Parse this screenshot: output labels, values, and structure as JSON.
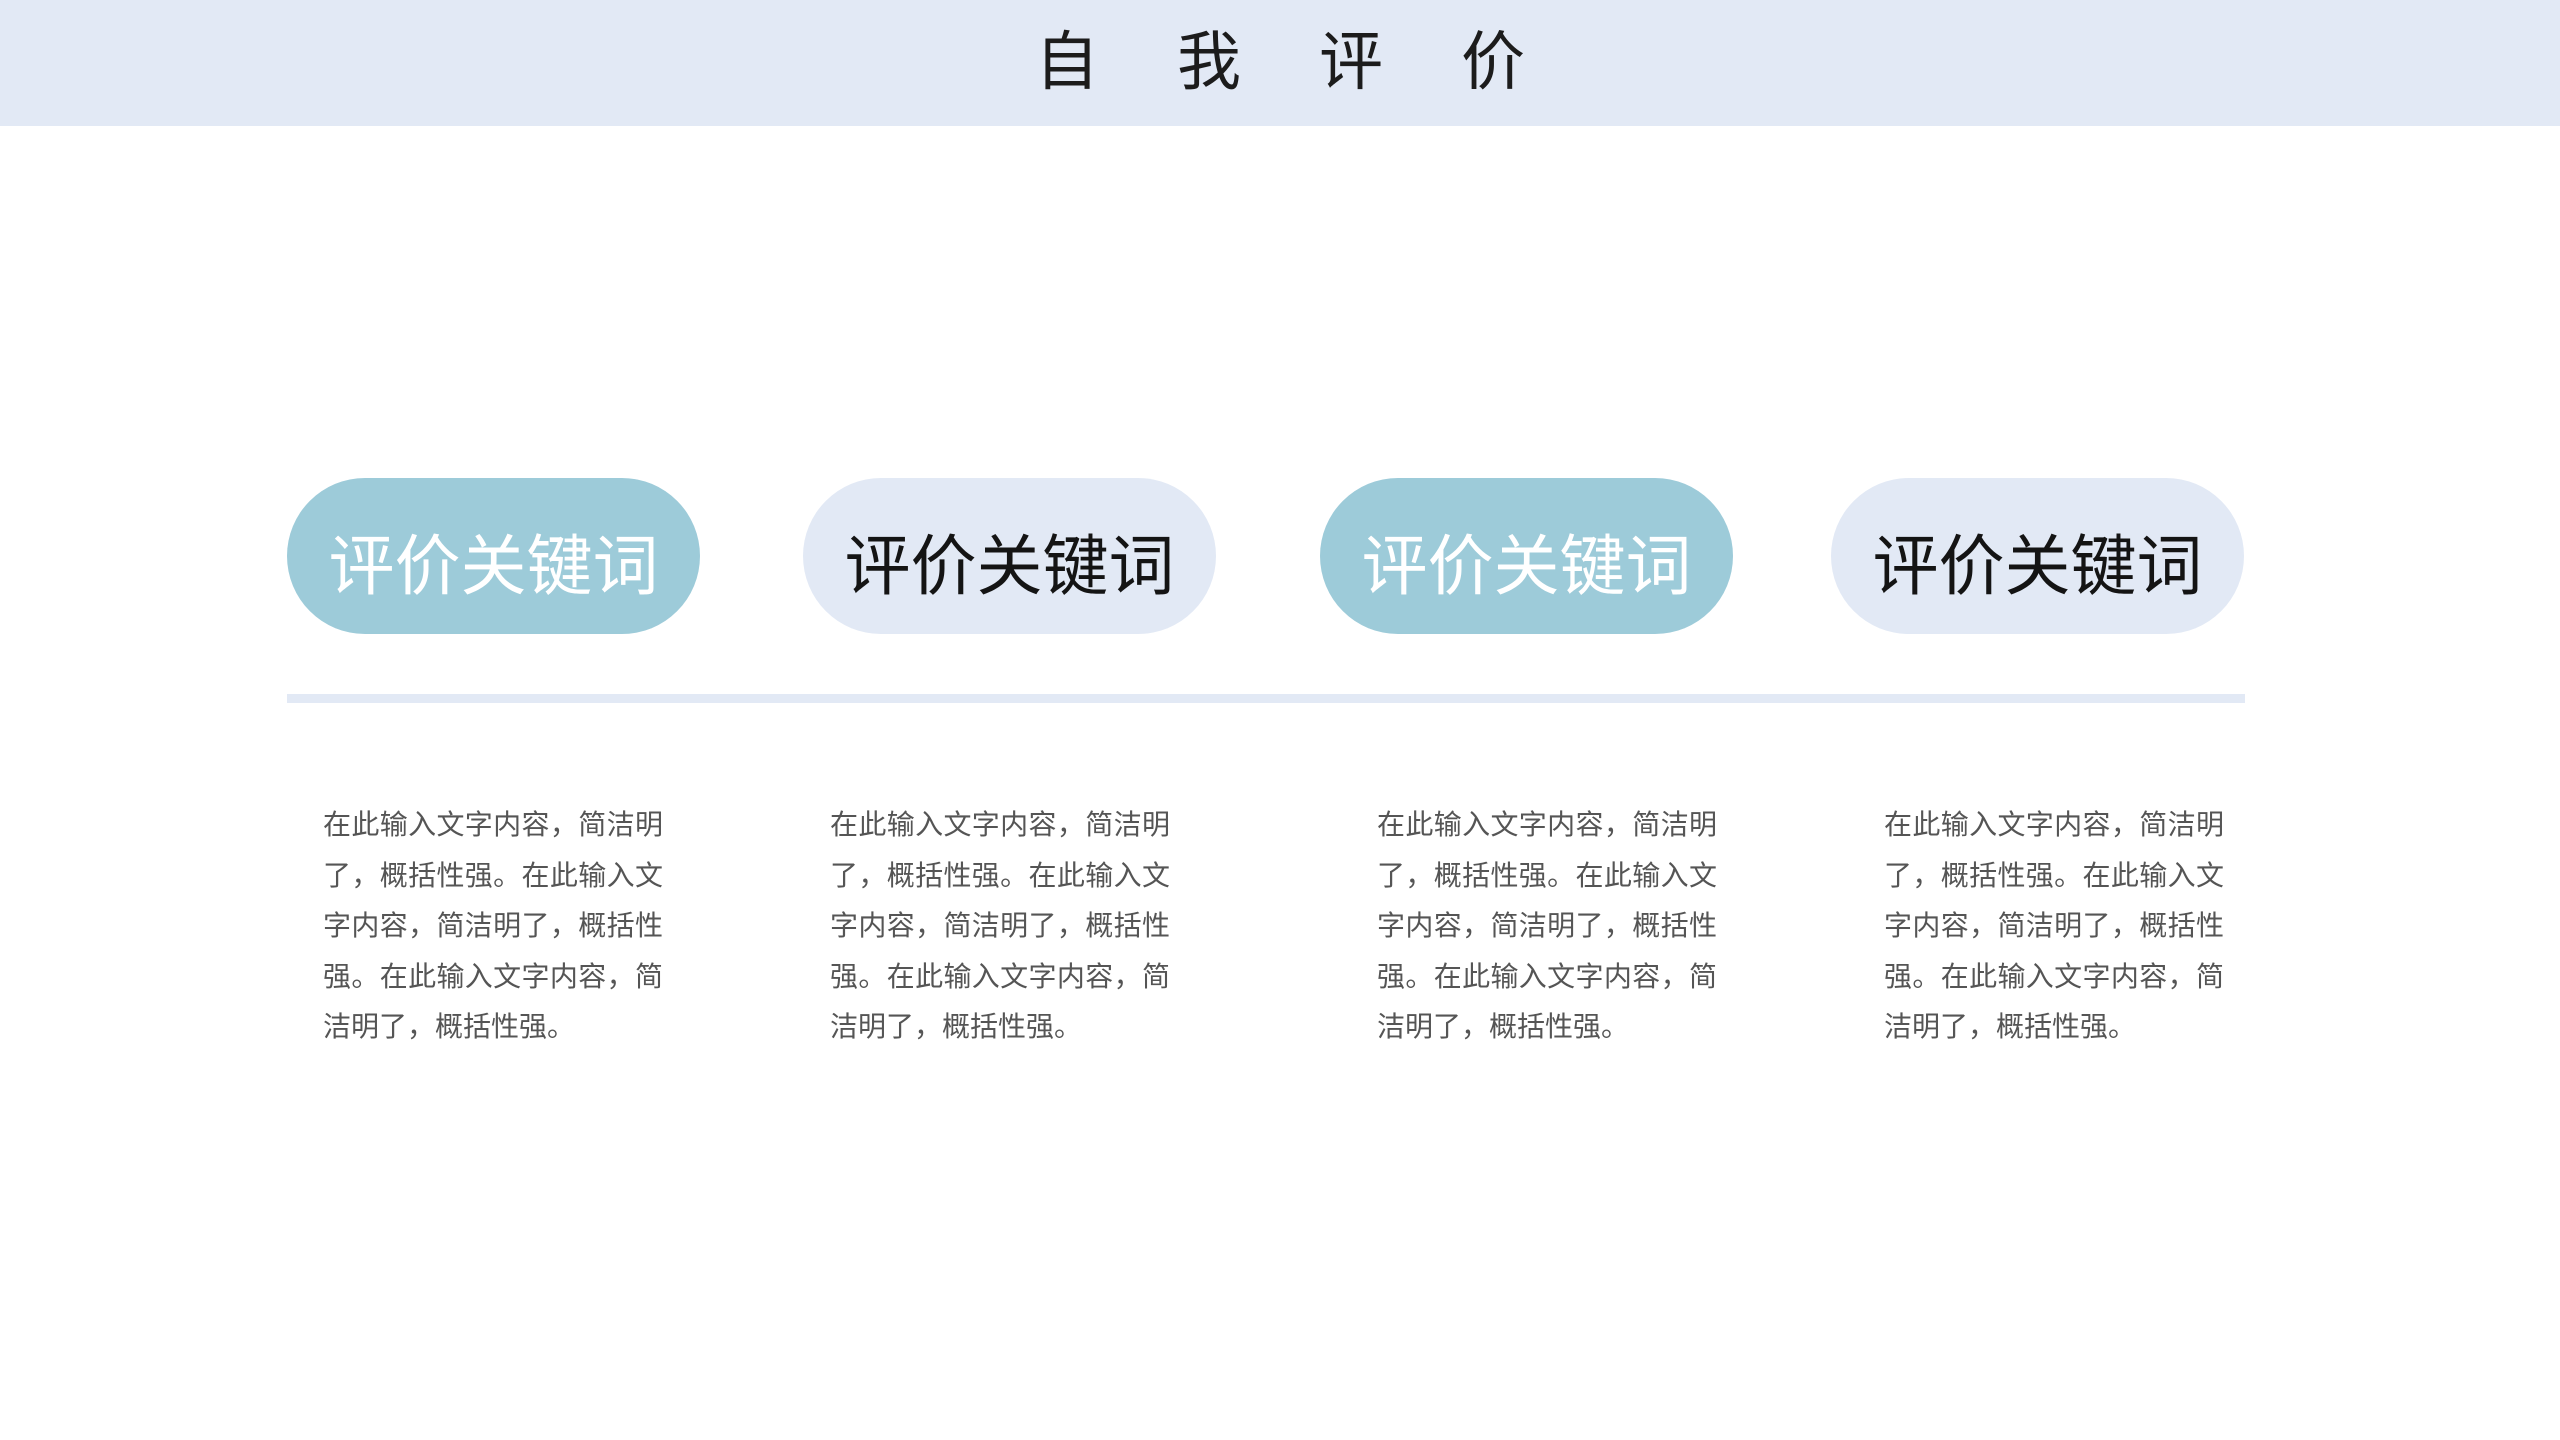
{
  "header": {
    "title": "自我评价"
  },
  "keywords": [
    {
      "label": "评价关键词",
      "style": "teal",
      "color": "#9dcbd9"
    },
    {
      "label": "评价关键词",
      "style": "light",
      "color": "#e2e9f5"
    },
    {
      "label": "评价关键词",
      "style": "teal",
      "color": "#9dcbd9"
    },
    {
      "label": "评价关键词",
      "style": "light",
      "color": "#e2e9f5"
    }
  ],
  "descriptions": [
    "在此输入文字内容，简洁明了，概括性强。在此输入文字内容，简洁明了，概括性强。在此输入文字内容，简洁明了，概括性强。",
    "在此输入文字内容，简洁明了，概括性强。在此输入文字内容，简洁明了，概括性强。在此输入文字内容，简洁明了，概括性强。",
    "在此输入文字内容，简洁明了，概括性强。在此输入文字内容，简洁明了，概括性强。在此输入文字内容，简洁明了，概括性强。",
    "在此输入文字内容，简洁明了，概括性强。在此输入文字内容，简洁明了，概括性强。在此输入文字内容，简洁明了，概括性强。"
  ],
  "colors": {
    "header_band": "#e2e9f5",
    "accent_teal": "#9dcbd9",
    "accent_light": "#e2e9f5",
    "body_text": "#555555"
  }
}
